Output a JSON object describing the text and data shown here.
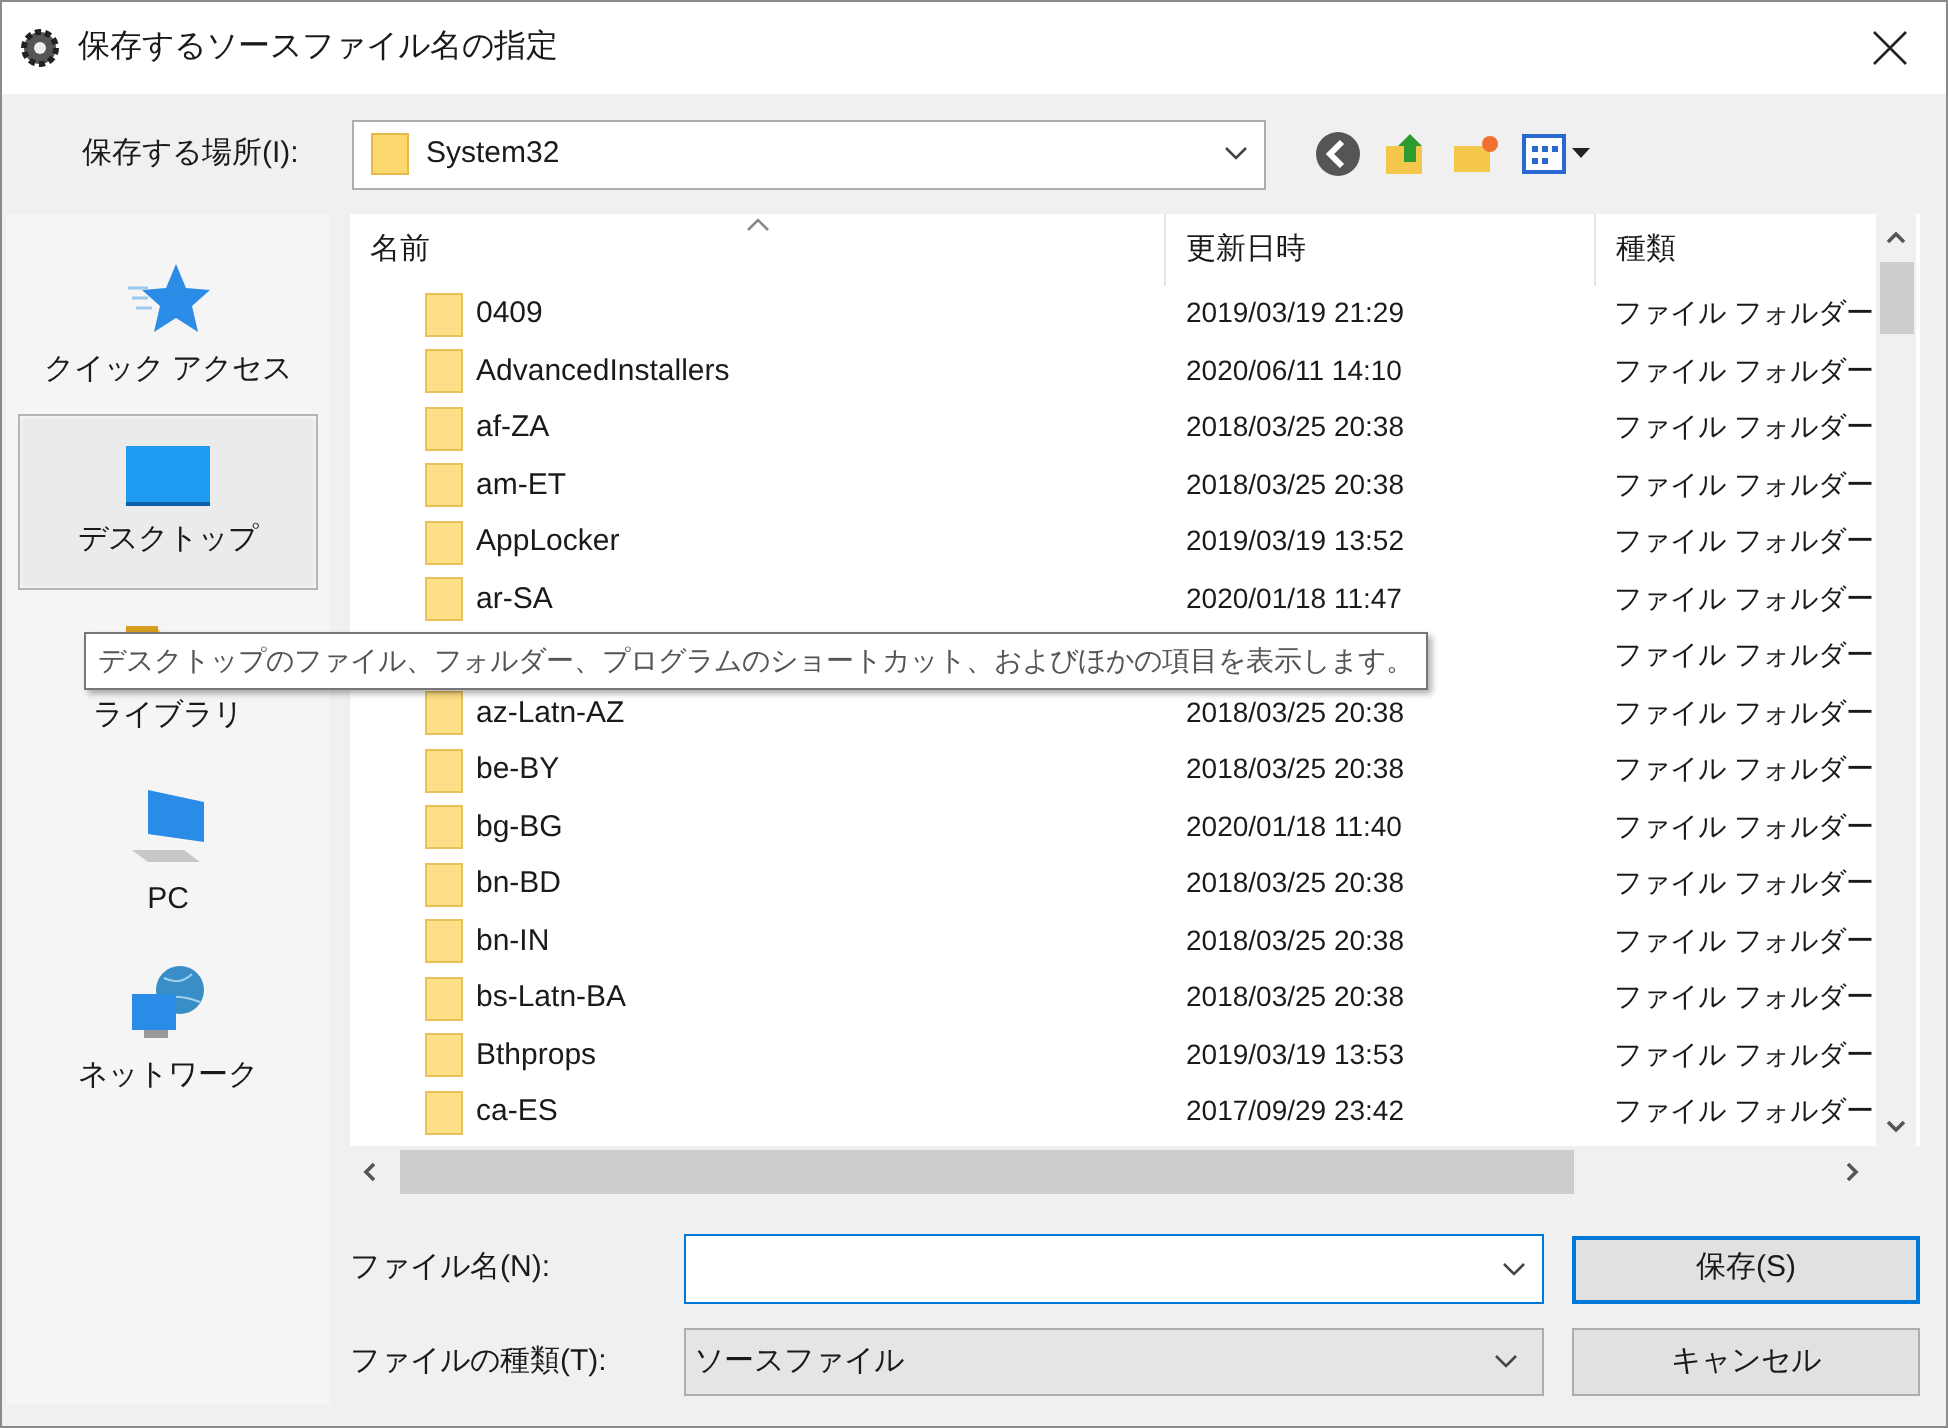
{
  "window": {
    "title": "保存するソースファイル名の指定"
  },
  "location": {
    "label": "保存する場所(I):",
    "value": "System32"
  },
  "sidebar": {
    "items": [
      {
        "label": "クイック アクセス",
        "kind": "star",
        "selected": false
      },
      {
        "label": "デスクトップ",
        "kind": "desktop",
        "selected": true
      },
      {
        "label": "ライブラリ",
        "kind": "library",
        "selected": false
      },
      {
        "label": "PC",
        "kind": "pc",
        "selected": false
      },
      {
        "label": "ネットワーク",
        "kind": "network",
        "selected": false
      }
    ]
  },
  "table": {
    "columns": [
      "名前",
      "更新日時",
      "種類"
    ],
    "rows": [
      {
        "name": "0409",
        "modified": "2019/03/19 21:29",
        "type": "ファイル フォルダー"
      },
      {
        "name": "AdvancedInstallers",
        "modified": "2020/06/11 14:10",
        "type": "ファイル フォルダー"
      },
      {
        "name": "af-ZA",
        "modified": "2018/03/25 20:38",
        "type": "ファイル フォルダー"
      },
      {
        "name": "am-ET",
        "modified": "2018/03/25 20:38",
        "type": "ファイル フォルダー"
      },
      {
        "name": "AppLocker",
        "modified": "2019/03/19 13:52",
        "type": "ファイル フォルダー"
      },
      {
        "name": "ar-SA",
        "modified": "2020/01/18 11:47",
        "type": "ファイル フォルダー"
      },
      {
        "type": "ファイル フォルダー"
      },
      {
        "name": "az-Latn-AZ",
        "modified": "2018/03/25 20:38",
        "type": "ファイル フォルダー"
      },
      {
        "name": "be-BY",
        "modified": "2018/03/25 20:38",
        "type": "ファイル フォルダー"
      },
      {
        "name": "bg-BG",
        "modified": "2020/01/18 11:40",
        "type": "ファイル フォルダー"
      },
      {
        "name": "bn-BD",
        "modified": "2018/03/25 20:38",
        "type": "ファイル フォルダー"
      },
      {
        "name": "bn-IN",
        "modified": "2018/03/25 20:38",
        "type": "ファイル フォルダー"
      },
      {
        "name": "bs-Latn-BA",
        "modified": "2018/03/25 20:38",
        "type": "ファイル フォルダー"
      },
      {
        "name": "Bthprops",
        "modified": "2019/03/19 13:53",
        "type": "ファイル フォルダー"
      },
      {
        "name": "ca-ES",
        "modified": "2017/09/29 23:42",
        "type": "ファイル フォルダー"
      }
    ]
  },
  "tooltip": "デスクトップのファイル、フォルダー、プログラムのショートカット、およびほかの項目を表示します。",
  "filename": {
    "label": "ファイル名(N):"
  },
  "filetype": {
    "label": "ファイルの種類(T):",
    "value": "ソースファイル"
  },
  "buttons": [
    "保存(S)",
    "キャンセル"
  ]
}
